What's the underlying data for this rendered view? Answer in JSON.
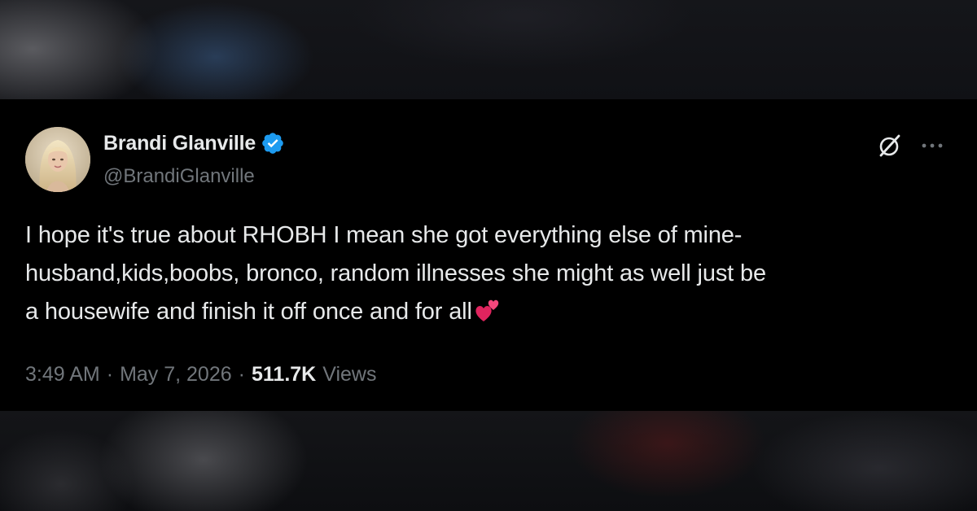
{
  "tweet": {
    "author": {
      "display_name": "Brandi Glanville",
      "handle": "@BrandiGlanville",
      "verified": true,
      "avatar": "profile-photo"
    },
    "text_lines": [
      "I hope it's true about RHOBH I mean she got everything else of mine-",
      "husband,kids,boobs, bronco, random illnesses she might as well just be",
      "a housewife and finish it off once and for all"
    ],
    "emoji": "two-hearts-emoji",
    "time": "3:49 AM",
    "separator": "·",
    "date": "May 7, 2026",
    "views_count": "511.7K",
    "views_label": "Views",
    "icons": {
      "grok": "grok-icon",
      "more": "more-options-icon",
      "verified": "verified-badge-icon"
    }
  },
  "colors": {
    "tweet_background": "#000000",
    "primary_text": "#e7e9ea",
    "secondary_text": "#71767b",
    "verified_blue": "#1d9bf0",
    "emoji_pink": "#e0245e"
  }
}
